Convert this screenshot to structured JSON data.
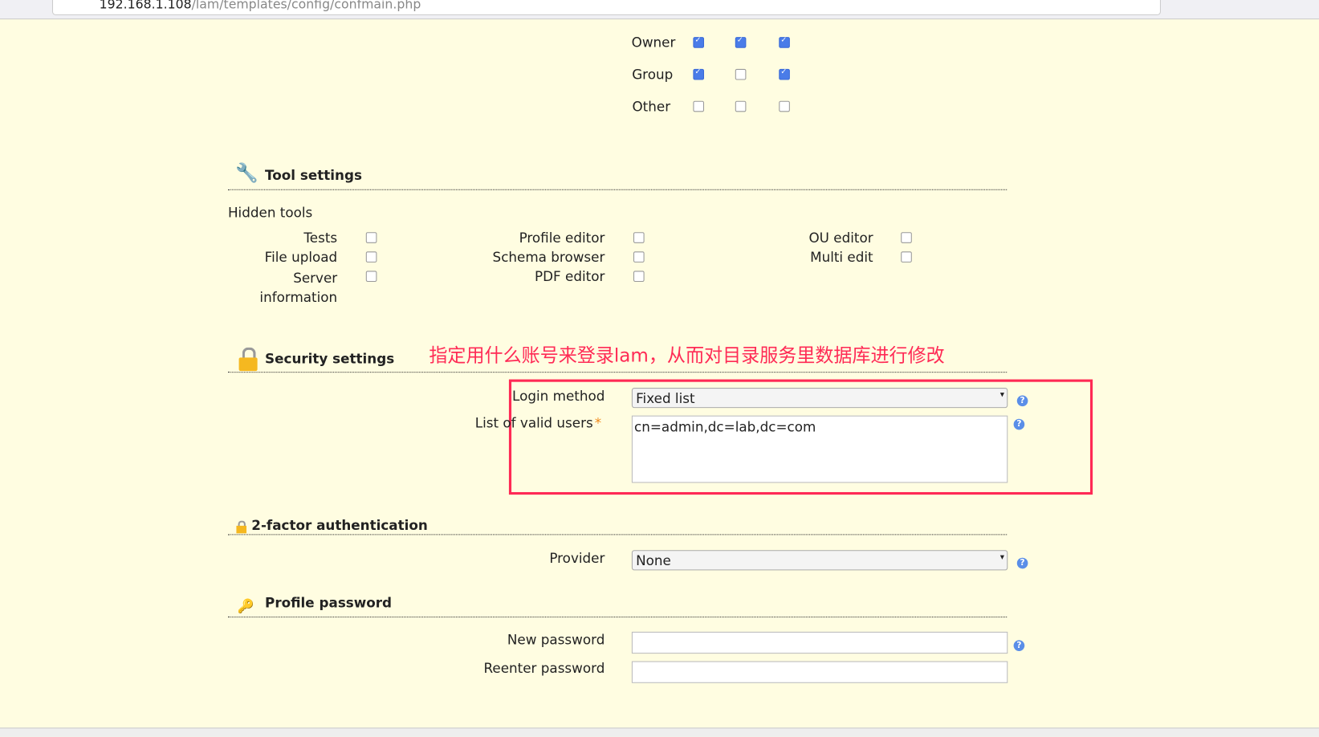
{
  "browser": {
    "url_host": "192.168.1.108",
    "url_path": "/lam/templates/config/confmain.php"
  },
  "permissions": {
    "rows": [
      {
        "label": "Owner",
        "values": [
          true,
          true,
          true
        ]
      },
      {
        "label": "Group",
        "values": [
          true,
          false,
          true
        ]
      },
      {
        "label": "Other",
        "values": [
          false,
          false,
          false
        ]
      }
    ]
  },
  "tool_settings": {
    "title": "Tool settings",
    "hidden_tools_label": "Hidden tools",
    "tools": [
      "Tests",
      "File upload",
      "Server information",
      "Profile editor",
      "Schema browser",
      "PDF editor",
      "OU editor",
      "Multi edit"
    ]
  },
  "security": {
    "title": "Security settings",
    "annotation": "指定用什么账号来登录lam，从而对目录服务里数据库进行修改",
    "login_method_label": "Login method",
    "login_method_value": "Fixed list",
    "valid_users_label": "List of valid users",
    "required_mark": "*",
    "valid_users_value": "cn=admin,dc=lab,dc=com"
  },
  "two_factor": {
    "title": "2-factor authentication",
    "provider_label": "Provider",
    "provider_value": "None"
  },
  "profile_password": {
    "title": "Profile password",
    "new_label": "New password",
    "reenter_label": "Reenter password"
  },
  "colors": {
    "background": "#fffde1",
    "annotation": "#ff2a55",
    "checkbox": "#4a7ce8"
  }
}
